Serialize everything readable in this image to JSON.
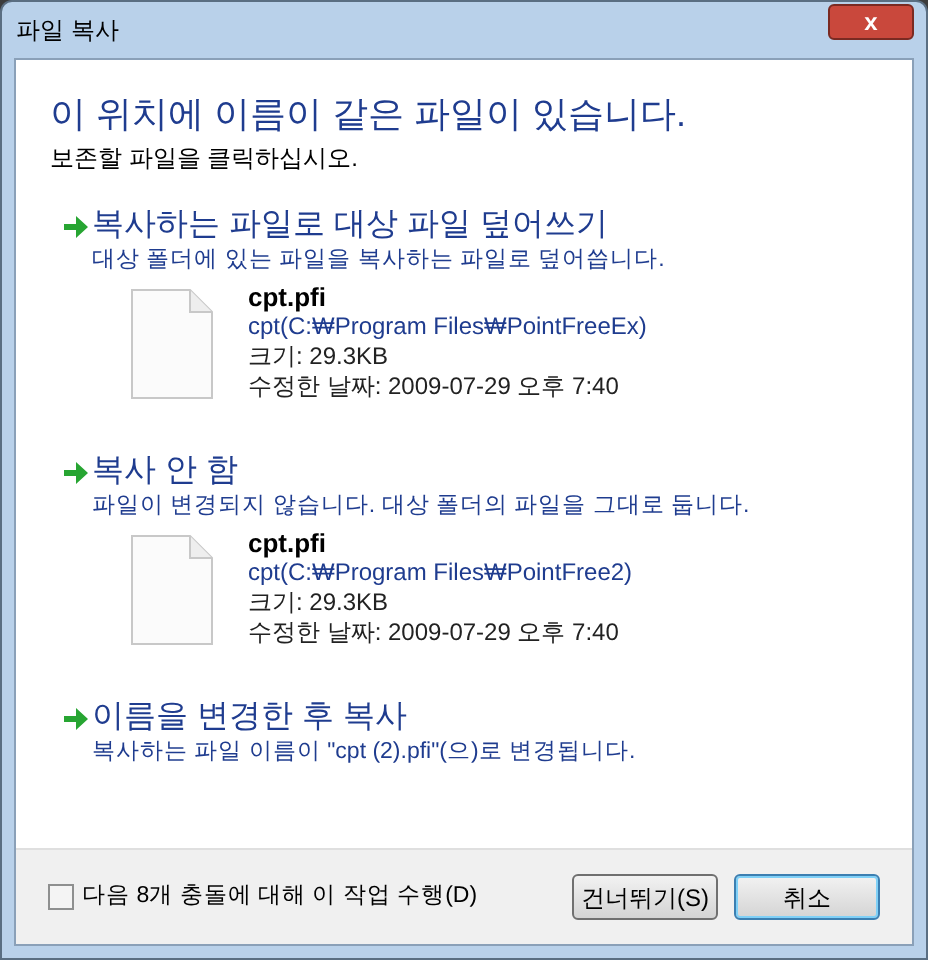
{
  "window": {
    "title": "파일 복사",
    "close": "x"
  },
  "heading": "이 위치에 이름이 같은 파일이 있습니다.",
  "instruction": "보존할 파일을 클릭하십시오.",
  "options": [
    {
      "title": "복사하는 파일로 대상 파일 덮어쓰기",
      "description": "대상 폴더에 있는 파일을 복사하는 파일로 덮어씁니다.",
      "file": {
        "name": "cpt.pfi",
        "location": "cpt(C:₩Program Files₩PointFreeEx)",
        "size": "크기: 29.3KB",
        "modified": "수정한 날짜: 2009-07-29 오후 7:40"
      }
    },
    {
      "title": "복사 안 함",
      "description": "파일이 변경되지 않습니다. 대상 폴더의 파일을 그대로 둡니다.",
      "file": {
        "name": "cpt.pfi",
        "location": "cpt(C:₩Program Files₩PointFree2)",
        "size": "크기: 29.3KB",
        "modified": "수정한 날짜: 2009-07-29 오후 7:40"
      }
    },
    {
      "title": "이름을 변경한 후 복사",
      "description": "복사하는 파일 이름이 \"cpt (2).pfi\"(으)로 변경됩니다."
    }
  ],
  "footer": {
    "apply_to_all": {
      "label": "다음 8개 충돌에 대해 이 작업 수행(D)",
      "checked": false
    },
    "buttons": [
      {
        "label": "건너뛰기(S)",
        "default": false
      },
      {
        "label": "취소",
        "default": true
      }
    ]
  }
}
